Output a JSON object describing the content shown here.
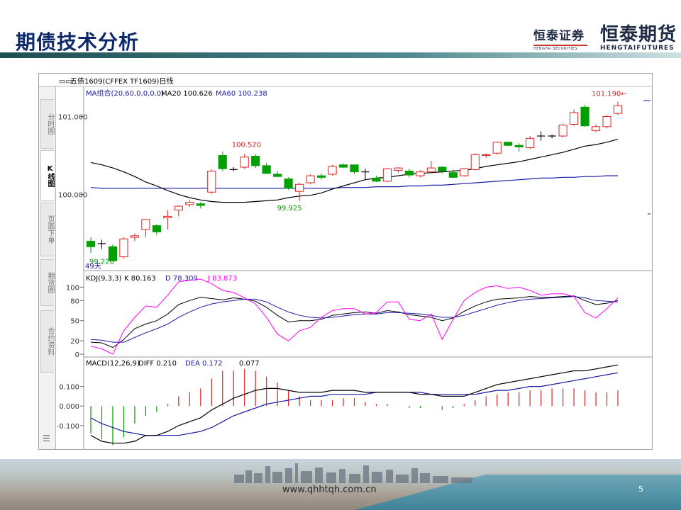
{
  "slide": {
    "title": "期债技术分析",
    "footer_url": "www.qhhtqh.com.cn",
    "page_number": "5"
  },
  "logos": {
    "securities": {
      "name": "恒泰证券",
      "sub": "HENGTAI SECURITIES"
    },
    "futures": {
      "name": "恒泰期货",
      "sub": "HENGTAIFUTURES"
    }
  },
  "side_tabs": [
    "分时图",
    "K线图",
    "页面下单",
    "期货圈",
    "合约资料"
  ],
  "colors": {
    "up": "#e02020",
    "down": "#00a000",
    "ma20": "#000000",
    "ma60": "#1a1aa6",
    "k": "#000000",
    "d": "#1a1aa6",
    "j": "#ff00ff",
    "title_blue": "#0e2a6b"
  },
  "chart_data": [
    {
      "type": "candlestick",
      "title": "五债1609(CFFEX TF1609)日线",
      "indicator_label": "MA组合(20,60,0,0,0,0)",
      "ma20_label": "MA20 100.626",
      "ma60_label": "MA60 100.238",
      "period_label": "49天",
      "y_ticks": [
        100.0,
        101.0
      ],
      "ylim": [
        99.06,
        101.35
      ],
      "annotations": [
        {
          "text": "101.190←",
          "x": 46,
          "y": 101.19
        },
        {
          "text": "100.520",
          "x": 14,
          "y": 100.52
        },
        {
          "text": "99.925",
          "x": 18,
          "y": 99.925
        },
        {
          "text": "99.220",
          "x": 0,
          "y": 99.22
        }
      ],
      "candles": [
        {
          "o": 99.4,
          "h": 99.45,
          "l": 99.25,
          "c": 99.33
        },
        {
          "o": 99.37,
          "h": 99.42,
          "l": 99.3,
          "c": 99.37
        },
        {
          "o": 99.33,
          "h": 99.36,
          "l": 99.14,
          "c": 99.15
        },
        {
          "o": 99.2,
          "h": 99.45,
          "l": 99.18,
          "c": 99.43
        },
        {
          "o": 99.45,
          "h": 99.5,
          "l": 99.4,
          "c": 99.47
        },
        {
          "o": 99.55,
          "h": 99.66,
          "l": 99.45,
          "c": 99.68
        },
        {
          "o": 99.6,
          "h": 99.62,
          "l": 99.48,
          "c": 99.52
        },
        {
          "o": 99.7,
          "h": 99.8,
          "l": 99.55,
          "c": 99.72
        },
        {
          "o": 99.8,
          "h": 99.86,
          "l": 99.72,
          "c": 99.85
        },
        {
          "o": 99.87,
          "h": 99.93,
          "l": 99.84,
          "c": 99.9
        },
        {
          "o": 99.88,
          "h": 99.9,
          "l": 99.82,
          "c": 99.86
        },
        {
          "o": 100.03,
          "h": 100.32,
          "l": 100.01,
          "c": 100.3
        },
        {
          "o": 100.5,
          "h": 100.55,
          "l": 100.3,
          "c": 100.33
        },
        {
          "o": 100.32,
          "h": 100.35,
          "l": 100.3,
          "c": 100.32
        },
        {
          "o": 100.35,
          "h": 100.52,
          "l": 100.33,
          "c": 100.48
        },
        {
          "o": 100.49,
          "h": 100.52,
          "l": 100.34,
          "c": 100.37
        },
        {
          "o": 100.37,
          "h": 100.41,
          "l": 100.27,
          "c": 100.27
        },
        {
          "o": 100.26,
          "h": 100.3,
          "l": 100.23,
          "c": 100.23
        },
        {
          "o": 100.2,
          "h": 100.22,
          "l": 100.06,
          "c": 100.08
        },
        {
          "o": 100.04,
          "h": 100.15,
          "l": 99.92,
          "c": 100.13
        },
        {
          "o": 100.15,
          "h": 100.26,
          "l": 100.13,
          "c": 100.24
        },
        {
          "o": 100.24,
          "h": 100.27,
          "l": 100.19,
          "c": 100.22
        },
        {
          "o": 100.26,
          "h": 100.38,
          "l": 100.24,
          "c": 100.36
        },
        {
          "o": 100.38,
          "h": 100.4,
          "l": 100.34,
          "c": 100.35
        },
        {
          "o": 100.38,
          "h": 100.38,
          "l": 100.26,
          "c": 100.29
        },
        {
          "o": 100.29,
          "h": 100.33,
          "l": 100.19,
          "c": 100.29
        },
        {
          "o": 100.21,
          "h": 100.24,
          "l": 100.16,
          "c": 100.17
        },
        {
          "o": 100.17,
          "h": 100.34,
          "l": 100.16,
          "c": 100.33
        },
        {
          "o": 100.31,
          "h": 100.35,
          "l": 100.28,
          "c": 100.34
        },
        {
          "o": 100.3,
          "h": 100.33,
          "l": 100.22,
          "c": 100.25
        },
        {
          "o": 100.24,
          "h": 100.31,
          "l": 100.22,
          "c": 100.29
        },
        {
          "o": 100.29,
          "h": 100.43,
          "l": 100.27,
          "c": 100.34
        },
        {
          "o": 100.35,
          "h": 100.36,
          "l": 100.27,
          "c": 100.3
        },
        {
          "o": 100.28,
          "h": 100.32,
          "l": 100.21,
          "c": 100.22
        },
        {
          "o": 100.24,
          "h": 100.34,
          "l": 100.23,
          "c": 100.33
        },
        {
          "o": 100.32,
          "h": 100.53,
          "l": 100.31,
          "c": 100.51
        },
        {
          "o": 100.5,
          "h": 100.53,
          "l": 100.47,
          "c": 100.51
        },
        {
          "o": 100.53,
          "h": 100.68,
          "l": 100.51,
          "c": 100.67
        },
        {
          "o": 100.67,
          "h": 100.68,
          "l": 100.62,
          "c": 100.63
        },
        {
          "o": 100.63,
          "h": 100.66,
          "l": 100.55,
          "c": 100.61
        },
        {
          "o": 100.6,
          "h": 100.75,
          "l": 100.58,
          "c": 100.72
        },
        {
          "o": 100.75,
          "h": 100.81,
          "l": 100.69,
          "c": 100.75
        },
        {
          "o": 100.75,
          "h": 100.77,
          "l": 100.72,
          "c": 100.75
        },
        {
          "o": 100.75,
          "h": 100.91,
          "l": 100.73,
          "c": 100.89
        },
        {
          "o": 100.9,
          "h": 101.09,
          "l": 100.88,
          "c": 101.05
        },
        {
          "o": 101.12,
          "h": 101.15,
          "l": 100.87,
          "c": 100.88
        },
        {
          "o": 100.82,
          "h": 100.9,
          "l": 100.8,
          "c": 100.87
        },
        {
          "o": 100.87,
          "h": 101.02,
          "l": 100.85,
          "c": 101.0
        },
        {
          "o": 101.04,
          "h": 101.19,
          "l": 101.02,
          "c": 101.14
        }
      ],
      "ma20": [
        100.41,
        100.38,
        100.34,
        100.29,
        100.23,
        100.16,
        100.11,
        100.05,
        100.0,
        99.96,
        99.93,
        99.91,
        99.9,
        99.9,
        99.9,
        99.91,
        99.92,
        99.93,
        99.96,
        99.98,
        99.99,
        100.02,
        100.07,
        100.11,
        100.15,
        100.19,
        100.21,
        100.22,
        100.24,
        100.26,
        100.27,
        100.28,
        100.29,
        100.3,
        100.31,
        100.33,
        100.36,
        100.38,
        100.4,
        100.42,
        100.45,
        100.48,
        100.51,
        100.54,
        100.58,
        100.62,
        100.64,
        100.67,
        100.71
      ],
      "ma60": [
        100.09,
        100.08,
        100.08,
        100.08,
        100.08,
        100.08,
        100.08,
        100.08,
        100.08,
        100.08,
        100.08,
        100.08,
        100.08,
        100.08,
        100.08,
        100.08,
        100.08,
        100.08,
        100.08,
        100.08,
        100.08,
        100.08,
        100.08,
        100.09,
        100.09,
        100.09,
        100.1,
        100.1,
        100.1,
        100.11,
        100.11,
        100.12,
        100.12,
        100.13,
        100.14,
        100.15,
        100.16,
        100.17,
        100.18,
        100.19,
        100.2,
        100.21,
        100.21,
        100.22,
        100.22,
        100.23,
        100.23,
        100.24,
        100.24
      ]
    },
    {
      "type": "line",
      "title": "KDJ(9,3,3)",
      "k_label": "K  80.163",
      "d_label": "D  78.309",
      "j_label": "J  83.873",
      "y_ticks": [
        0,
        20,
        50,
        80,
        100
      ],
      "ylim": [
        -2,
        112
      ],
      "series": [
        {
          "key": "k",
          "values": [
            18,
            17,
            10,
            22,
            38,
            45,
            50,
            60,
            74,
            80,
            85,
            83,
            81,
            84,
            82,
            79,
            70,
            58,
            48,
            50,
            50,
            52,
            58,
            60,
            62,
            63,
            61,
            65,
            63,
            59,
            57,
            55,
            50,
            54,
            64,
            72,
            78,
            82,
            83,
            84,
            86,
            85,
            85,
            86,
            87,
            80,
            74,
            76,
            80
          ]
        },
        {
          "key": "d",
          "values": [
            22,
            21,
            18,
            18,
            25,
            32,
            38,
            45,
            55,
            63,
            70,
            75,
            78,
            80,
            82,
            82,
            78,
            70,
            63,
            58,
            55,
            54,
            55,
            57,
            59,
            60,
            60,
            62,
            62,
            61,
            60,
            58,
            55,
            55,
            58,
            63,
            68,
            73,
            77,
            80,
            82,
            83,
            84,
            85,
            86,
            84,
            80,
            79,
            78
          ]
        },
        {
          "key": "j",
          "values": [
            12,
            8,
            0,
            35,
            55,
            72,
            70,
            88,
            108,
            110,
            112,
            105,
            95,
            92,
            84,
            75,
            55,
            30,
            20,
            35,
            40,
            55,
            65,
            68,
            68,
            60,
            62,
            78,
            78,
            52,
            50,
            60,
            22,
            52,
            80,
            92,
            100,
            102,
            98,
            100,
            95,
            88,
            90,
            90,
            86,
            62,
            54,
            68,
            84
          ]
        }
      ]
    },
    {
      "type": "bar",
      "title": "MACD(12,26,9)",
      "diff_label": "DIFF  0.210",
      "dea_label": "DEA  0.172",
      "macd_label": "0.077",
      "y_ticks": [
        -0.1,
        0.0,
        0.1
      ],
      "ylim": [
        -0.22,
        0.2
      ],
      "diff": [
        -0.15,
        -0.18,
        -0.19,
        -0.19,
        -0.18,
        -0.15,
        -0.15,
        -0.13,
        -0.1,
        -0.08,
        -0.06,
        -0.02,
        0.01,
        0.04,
        0.06,
        0.08,
        0.09,
        0.09,
        0.08,
        0.07,
        0.07,
        0.07,
        0.08,
        0.08,
        0.08,
        0.07,
        0.07,
        0.07,
        0.07,
        0.07,
        0.06,
        0.06,
        0.05,
        0.05,
        0.05,
        0.07,
        0.09,
        0.11,
        0.12,
        0.13,
        0.14,
        0.15,
        0.16,
        0.17,
        0.18,
        0.18,
        0.19,
        0.2,
        0.21
      ],
      "dea": [
        -0.06,
        -0.09,
        -0.11,
        -0.13,
        -0.14,
        -0.15,
        -0.15,
        -0.15,
        -0.15,
        -0.14,
        -0.13,
        -0.11,
        -0.08,
        -0.05,
        -0.03,
        -0.01,
        0.01,
        0.02,
        0.03,
        0.04,
        0.05,
        0.05,
        0.06,
        0.06,
        0.06,
        0.06,
        0.07,
        0.07,
        0.07,
        0.07,
        0.07,
        0.06,
        0.06,
        0.06,
        0.06,
        0.06,
        0.07,
        0.08,
        0.08,
        0.09,
        0.1,
        0.1,
        0.11,
        0.12,
        0.13,
        0.14,
        0.15,
        0.16,
        0.17
      ],
      "macd": [
        -0.14,
        -0.17,
        -0.2,
        -0.16,
        -0.09,
        -0.05,
        -0.03,
        0.01,
        0.05,
        0.07,
        0.09,
        0.14,
        0.18,
        0.18,
        0.19,
        0.18,
        0.15,
        0.12,
        0.08,
        0.05,
        0.03,
        0.03,
        0.03,
        0.04,
        0.04,
        0.02,
        0.01,
        0.01,
        0.0,
        -0.01,
        -0.01,
        0.0,
        -0.02,
        -0.01,
        0.01,
        0.03,
        0.05,
        0.06,
        0.07,
        0.07,
        0.08,
        0.08,
        0.09,
        0.09,
        0.09,
        0.08,
        0.07,
        0.07,
        0.08
      ]
    }
  ]
}
